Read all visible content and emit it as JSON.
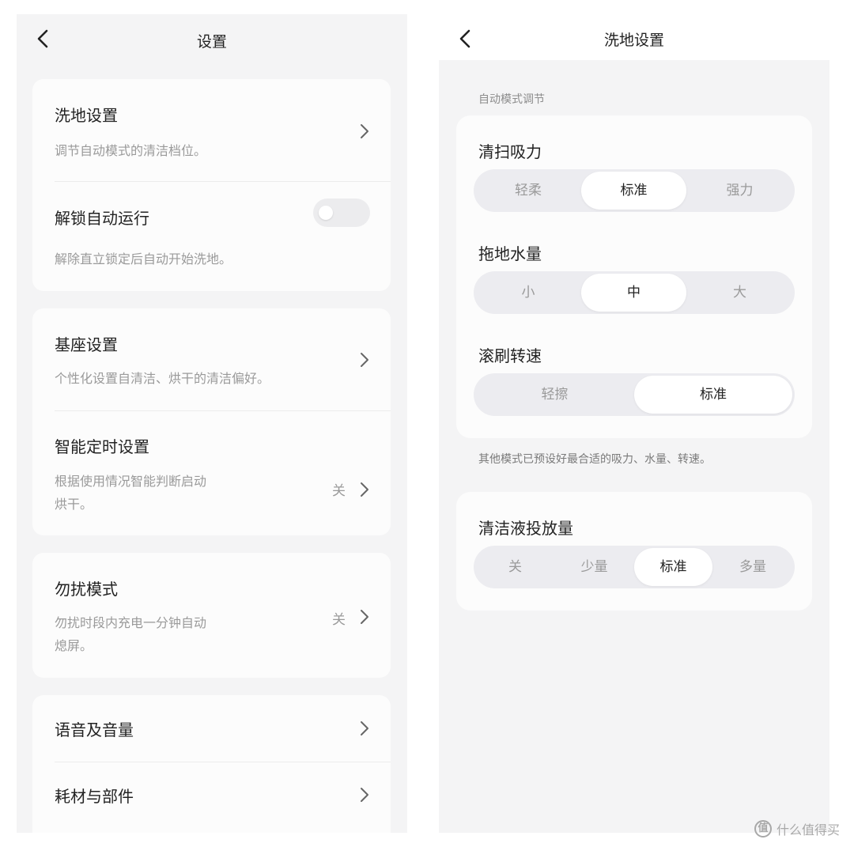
{
  "left": {
    "title": "设置",
    "groups": [
      {
        "items": [
          {
            "title": "洗地设置",
            "desc": "调节自动模式的清洁档位。",
            "control": "chevron"
          },
          {
            "title": "解锁自动运行",
            "desc": "解除直立锁定后自动开始洗地。",
            "control": "toggle",
            "toggle_on": false
          }
        ]
      },
      {
        "items": [
          {
            "title": "基座设置",
            "desc": "个性化设置自清洁、烘干的清洁偏好。",
            "control": "chevron"
          },
          {
            "title": "智能定时设置",
            "desc_lines": [
              "根据使用情况智能判断启动",
              "烘干。"
            ],
            "value": "关",
            "control": "chevron"
          }
        ]
      },
      {
        "items": [
          {
            "title": "勿扰模式",
            "desc_lines": [
              "勿扰时段内充电一分钟自动",
              "熄屏。"
            ],
            "value": "关",
            "control": "chevron"
          }
        ]
      },
      {
        "items": [
          {
            "title": "语音及音量",
            "control": "chevron"
          },
          {
            "title": "耗材与部件",
            "control": "chevron"
          }
        ]
      }
    ]
  },
  "right": {
    "title": "洗地设置",
    "section_label": "自动模式调节",
    "settings": [
      {
        "label": "清扫吸力",
        "options": [
          "轻柔",
          "标准",
          "强力"
        ],
        "selected": "标准"
      },
      {
        "label": "拖地水量",
        "options": [
          "小",
          "中",
          "大"
        ],
        "selected": "中"
      },
      {
        "label": "滚刷转速",
        "options": [
          "轻擦",
          "标准"
        ],
        "selected": "标准"
      }
    ],
    "note": "其他模式已预设好最合适的吸力、水量、转速。",
    "detergent": {
      "label": "清洁液投放量",
      "options": [
        "关",
        "少量",
        "标准",
        "多量"
      ],
      "selected": "标准"
    }
  },
  "watermark": {
    "logo_text": "值",
    "text": "什么值得买"
  },
  "icons": {
    "back": "chevron-left-icon",
    "next": "chevron-right-icon"
  }
}
